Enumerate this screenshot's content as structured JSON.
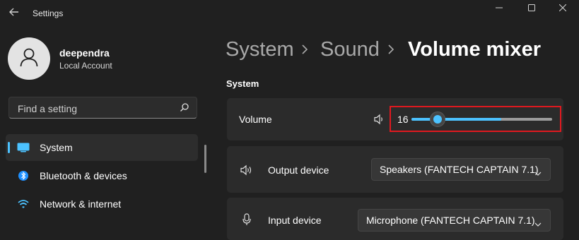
{
  "window": {
    "title": "Settings",
    "back_icon": "back-arrow-icon",
    "controls": [
      "minimize-icon",
      "maximize-icon",
      "close-icon"
    ]
  },
  "account": {
    "name": "deependra",
    "type": "Local Account",
    "avatar_icon": "person-icon"
  },
  "search": {
    "placeholder": "Find a setting",
    "value": "",
    "icon": "search-icon"
  },
  "nav": {
    "items": [
      {
        "label": "System",
        "icon": "monitor-icon",
        "active": true
      },
      {
        "label": "Bluetooth & devices",
        "icon": "bluetooth-icon",
        "active": false
      },
      {
        "label": "Network & internet",
        "icon": "wifi-icon",
        "active": false
      }
    ]
  },
  "breadcrumb": {
    "items": [
      "System",
      "Sound"
    ],
    "current": "Volume mixer",
    "separator_icon": "chevron-right-icon"
  },
  "section": {
    "title": "System"
  },
  "volume": {
    "label": "Volume",
    "value": "16",
    "level_percent": 16,
    "icon": "speaker-icon",
    "highlight_color": "#e0191f"
  },
  "output_device": {
    "label": "Output device",
    "icon": "speaker-wave-icon",
    "selected": "Speakers (FANTECH CAPTAIN 7.1)"
  },
  "input_device": {
    "label": "Input device",
    "icon": "microphone-icon",
    "selected": "Microphone (FANTECH CAPTAIN 7.1)"
  },
  "colors": {
    "accent": "#4cc2ff",
    "background": "#202020",
    "card": "#2b2b2b"
  }
}
